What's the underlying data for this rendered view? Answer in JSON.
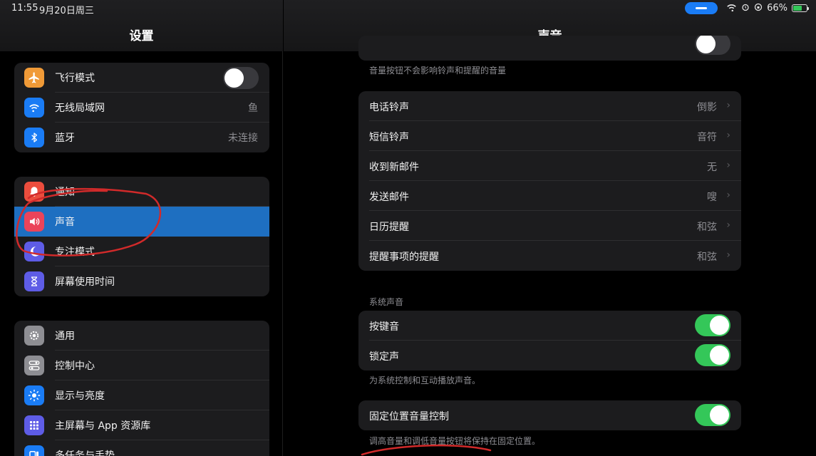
{
  "status_bar": {
    "time": "11:55",
    "date": "9月20日周三",
    "battery": "66%",
    "battery_level": 0.66
  },
  "sidebar": {
    "title": "设置",
    "group1": [
      {
        "label": "飞行模式",
        "icon": "airplane-icon",
        "color": "#f09a37",
        "toggle": false
      },
      {
        "label": "无线局域网",
        "icon": "wifi-icon",
        "color": "#1a7cf5",
        "value": "鱼"
      },
      {
        "label": "蓝牙",
        "icon": "bluetooth-icon",
        "color": "#1a7cf5",
        "value": "未连接"
      }
    ],
    "group2": [
      {
        "label": "通知",
        "icon": "bell-icon",
        "color": "#eb4d3d"
      },
      {
        "label": "声音",
        "icon": "speaker-icon",
        "color": "#eb445a",
        "selected": true
      },
      {
        "label": "专注模式",
        "icon": "moon-icon",
        "color": "#5e5ce6"
      },
      {
        "label": "屏幕使用时间",
        "icon": "hourglass-icon",
        "color": "#5e5ce6"
      }
    ],
    "group3": [
      {
        "label": "通用",
        "icon": "gear-icon",
        "color": "#8e8e93"
      },
      {
        "label": "控制中心",
        "icon": "toggles-icon",
        "color": "#8e8e93"
      },
      {
        "label": "显示与亮度",
        "icon": "sun-icon",
        "color": "#1a7cf5"
      },
      {
        "label": "主屏幕与 App 资源库",
        "icon": "grid-icon",
        "color": "#5e5ce6"
      },
      {
        "label": "多任务与手势",
        "icon": "multitask-icon",
        "color": "#1a7cf5"
      }
    ]
  },
  "detail": {
    "title": "声音",
    "top_note": "音量按钮不会影响铃声和提醒的音量",
    "sounds": [
      {
        "label": "电话铃声",
        "value": "倒影"
      },
      {
        "label": "短信铃声",
        "value": "音符"
      },
      {
        "label": "收到新邮件",
        "value": "无"
      },
      {
        "label": "发送邮件",
        "value": "嗖"
      },
      {
        "label": "日历提醒",
        "value": "和弦"
      },
      {
        "label": "提醒事项的提醒",
        "value": "和弦"
      }
    ],
    "system_section_title": "系统声音",
    "system": [
      {
        "label": "按键音",
        "on": true
      },
      {
        "label": "锁定声",
        "on": true
      }
    ],
    "system_note": "为系统控制和互动播放声音。",
    "fixed": {
      "label": "固定位置音量控制",
      "on": true
    },
    "fixed_note": "调高音量和调低音量按钮将保持在固定位置。"
  },
  "colors": {
    "selected_row": "#1e6fc1",
    "toggle_on": "#34c759",
    "annotation": "#d12a2a"
  }
}
